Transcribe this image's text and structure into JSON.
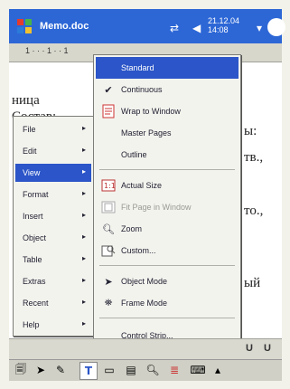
{
  "titlebar": {
    "app_title": "Memo.doc",
    "clock_line1": "21.12.04",
    "clock_line2": "14:08"
  },
  "ruler": {
    "text": "1 · · · 1 · · 1"
  },
  "document": {
    "lines": [
      "ница",
      "Состав:",
      "ы:",
      "тв.,",
      "то.,",
      "ый"
    ]
  },
  "menu": {
    "items": [
      {
        "label": "File",
        "arrow": "▸"
      },
      {
        "label": "Edit",
        "arrow": "▸"
      },
      {
        "label": "View",
        "arrow": "▸"
      },
      {
        "label": "Format",
        "arrow": "▸"
      },
      {
        "label": "Insert",
        "arrow": "▸"
      },
      {
        "label": "Object",
        "arrow": "▸"
      },
      {
        "label": "Table",
        "arrow": "▸"
      },
      {
        "label": "Extras",
        "arrow": "▸"
      },
      {
        "label": "Recent",
        "arrow": "▸"
      },
      {
        "label": "Help",
        "arrow": "▸"
      }
    ]
  },
  "submenu": {
    "items": [
      {
        "label": "Standard"
      },
      {
        "label": "Continuous"
      },
      {
        "label": "Wrap to Window"
      },
      {
        "label": "Master Pages"
      },
      {
        "label": "Outline"
      },
      {
        "label": "Actual Size"
      },
      {
        "label": "Fit Page in Window"
      },
      {
        "label": "Zoom"
      },
      {
        "label": "Custom..."
      },
      {
        "label": "Object Mode"
      },
      {
        "label": "Frame Mode"
      },
      {
        "label": "Control Strip..."
      }
    ]
  },
  "formatbar": {
    "u": "U",
    "u2": "U"
  },
  "colors": {
    "titlebar": "#2d67d6",
    "selection": "#2b55c8"
  }
}
